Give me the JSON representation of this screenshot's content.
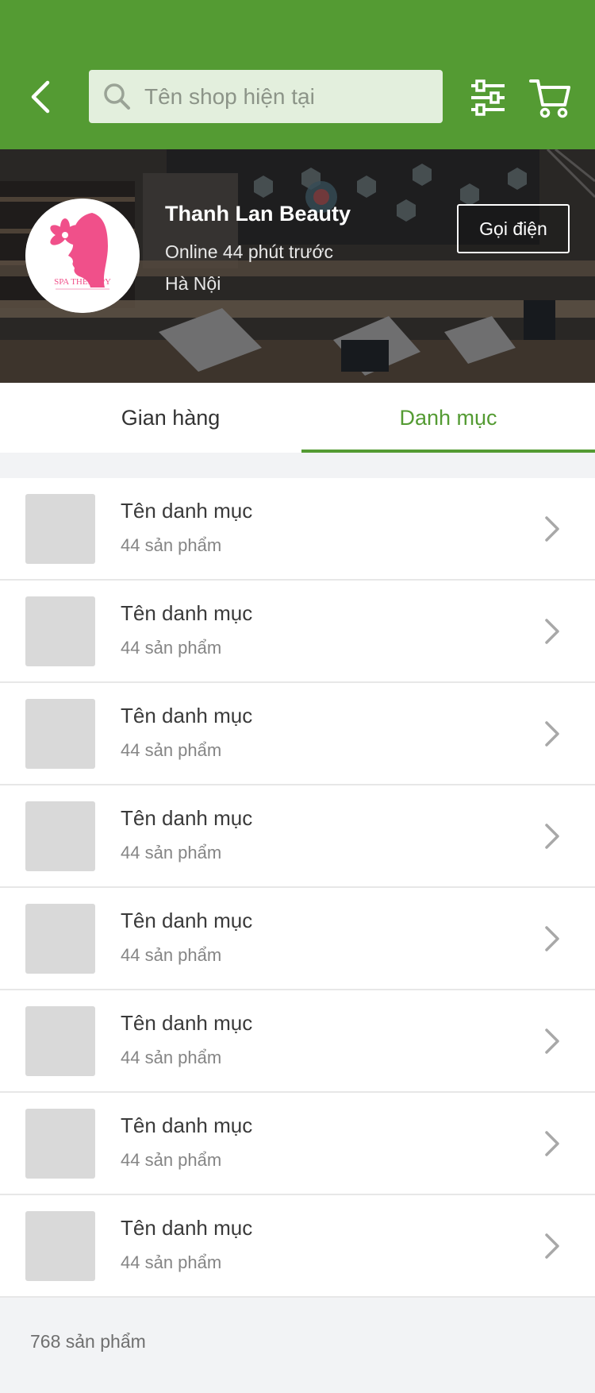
{
  "header": {
    "search_placeholder": "Tên shop hiện tại",
    "back_icon": "back-arrow-icon",
    "filter_icon": "filter-sliders-icon",
    "cart_icon": "cart-icon",
    "colors": {
      "primary": "#549b33",
      "search_bg": "#e3efdd"
    }
  },
  "shop": {
    "name": "Thanh Lan Beauty",
    "status": "Online 44 phút trước",
    "location": "Hà Nội",
    "call_label": "Gọi điện",
    "logo_text": "SPA THERAPY",
    "logo_color": "#f0508a"
  },
  "tabs": [
    {
      "label": "Gian hàng",
      "active": false
    },
    {
      "label": "Danh mục",
      "active": true
    }
  ],
  "categories": [
    {
      "title": "Tên danh mục",
      "count": "44 sản phẩm"
    },
    {
      "title": "Tên danh mục",
      "count": "44 sản phẩm"
    },
    {
      "title": "Tên danh mục",
      "count": "44 sản phẩm"
    },
    {
      "title": "Tên danh mục",
      "count": "44 sản phẩm"
    },
    {
      "title": "Tên danh mục",
      "count": "44 sản phẩm"
    },
    {
      "title": "Tên danh mục",
      "count": "44 sản phẩm"
    },
    {
      "title": "Tên danh mục",
      "count": "44 sản phẩm"
    },
    {
      "title": "Tên danh mục",
      "count": "44 sản phẩm"
    }
  ],
  "footer": {
    "total": "768 sản phẩm"
  }
}
